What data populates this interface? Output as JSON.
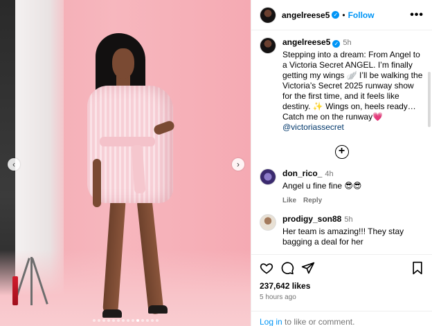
{
  "header": {
    "username": "angelreese5",
    "separator": "•",
    "follow_label": "Follow",
    "more_label": "•••"
  },
  "media": {
    "prev_label": "‹",
    "next_label": "›",
    "page_count": 14,
    "active_index": 9
  },
  "caption": {
    "username": "angelreese5",
    "time": "5h",
    "text": "Stepping into a dream: From Angel to a Victoria Secret ANGEL. I’m finally getting my wings 🪽 I’ll be walking the Victoria’s Secret 2025 runway show for the first time, and it feels like destiny. ✨ Wings on, heels ready… Catch me on the runway💗",
    "mention": "@victoriassecret"
  },
  "load_more_label": "+",
  "comments": [
    {
      "username": "don_rico_",
      "time": "4h",
      "text": "Angel u fine fine 😎😎",
      "like_label": "Like",
      "reply_label": "Reply"
    },
    {
      "username": "prodigy_son88",
      "time": "5h",
      "text": "Her team is amazing!!! They stay bagging a deal for her"
    }
  ],
  "actions": {
    "likes": "237,642 likes",
    "posted_ago": "5 hours ago"
  },
  "login": {
    "link_label": "Log in",
    "suffix": " to like or comment."
  },
  "colors": {
    "accent": "#0095f6",
    "backdrop_pink": "#f7b7be",
    "muted_text": "#737373"
  }
}
